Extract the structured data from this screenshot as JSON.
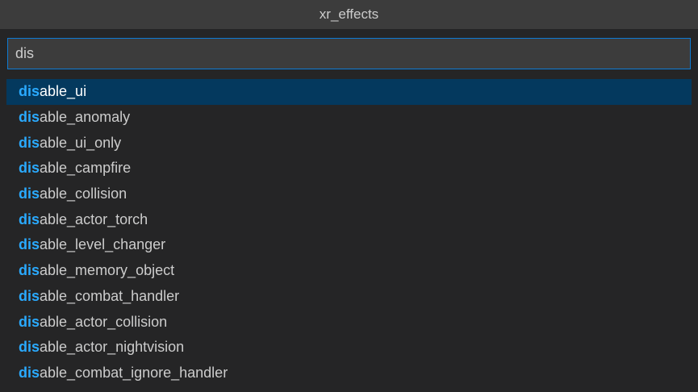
{
  "title": "xr_effects",
  "search": {
    "value": "dis",
    "placeholder": ""
  },
  "colors": {
    "background": "#252526",
    "title_bar": "#3c3c3c",
    "input_border": "#0e7ad3",
    "selected_row": "#04395e",
    "match_highlight": "#2aaaff",
    "text": "#cccccc"
  },
  "selected_index": 0,
  "items": [
    {
      "match": "dis",
      "rest": "able_ui"
    },
    {
      "match": "dis",
      "rest": "able_anomaly"
    },
    {
      "match": "dis",
      "rest": "able_ui_only"
    },
    {
      "match": "dis",
      "rest": "able_campfire"
    },
    {
      "match": "dis",
      "rest": "able_collision"
    },
    {
      "match": "dis",
      "rest": "able_actor_torch"
    },
    {
      "match": "dis",
      "rest": "able_level_changer"
    },
    {
      "match": "dis",
      "rest": "able_memory_object"
    },
    {
      "match": "dis",
      "rest": "able_combat_handler"
    },
    {
      "match": "dis",
      "rest": "able_actor_collision"
    },
    {
      "match": "dis",
      "rest": "able_actor_nightvision"
    },
    {
      "match": "dis",
      "rest": "able_combat_ignore_handler"
    }
  ]
}
